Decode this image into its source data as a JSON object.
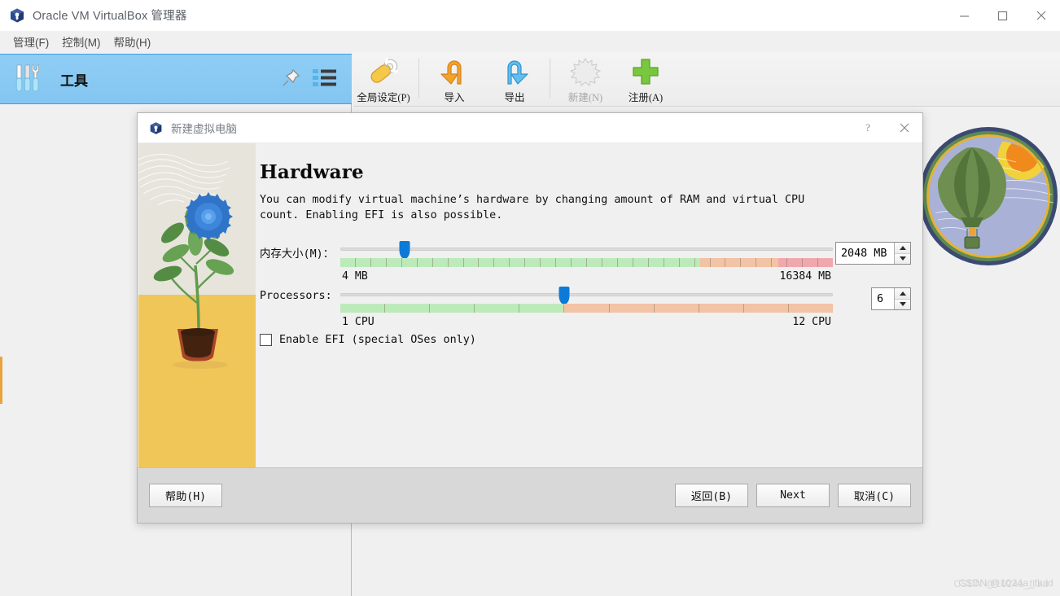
{
  "window": {
    "title": "Oracle VM VirtualBox 管理器",
    "icon": "virtualbox-cube-icon",
    "controls": {
      "minimize": "minimize-icon",
      "maximize": "maximize-icon",
      "close": "close-icon"
    }
  },
  "menubar": {
    "items": [
      {
        "label": "管理(F)"
      },
      {
        "label": "控制(M)"
      },
      {
        "label": "帮助(H)"
      }
    ]
  },
  "toolbar": {
    "buttons": [
      {
        "label": "全局设定(P)",
        "icon": "preferences-icon",
        "disabled": false
      },
      {
        "label": "导入",
        "icon": "import-appliance-icon",
        "disabled": false
      },
      {
        "label": "导出",
        "icon": "export-appliance-icon",
        "disabled": false
      },
      {
        "label": "新建(N)",
        "icon": "new-machine-icon",
        "disabled": true
      },
      {
        "label": "注册(A)",
        "icon": "register-machine-icon",
        "disabled": false
      }
    ]
  },
  "tools_strip": {
    "label": "工具",
    "tools_icon": "tools-icon",
    "pin_icon": "pin-icon",
    "list_icon": "list-view-icon"
  },
  "dialog": {
    "title": "新建虚拟电脑",
    "icon": "virtualbox-cube-icon",
    "help_icon": "help-question-icon",
    "close_icon": "close-icon",
    "heading": "Hardware",
    "description": "You can modify virtual machine’s hardware by changing amount of RAM and virtual CPU count. Enabling EFI is also possible.",
    "memory": {
      "label": "内存大小(M)：",
      "value": "2048 MB",
      "min_label": "4 MB",
      "max_label": "16384 MB",
      "handle_percent": 13,
      "bands": [
        {
          "color": "#bdeabb",
          "percent": 73
        },
        {
          "color": "#f2c3a5",
          "percent": 16
        },
        {
          "color": "#f0a8ad",
          "percent": 11
        }
      ],
      "tick_count": 32
    },
    "processors": {
      "label": "Processors:",
      "value": "6",
      "min_label": "1 CPU",
      "max_label": "12 CPU",
      "handle_percent": 45.5,
      "bands": [
        {
          "color": "#bdeabb",
          "percent": 45.5
        },
        {
          "color": "#f2c3a5",
          "percent": 54.5
        }
      ],
      "tick_count": 11
    },
    "efi": {
      "label": "Enable EFI (special OSes only)",
      "checked": false
    },
    "footer": {
      "help": "帮助(H)",
      "back": "返回(B)",
      "next": "Next",
      "cancel": "取消(C)"
    }
  },
  "watermark": {
    "text": "CSDN @1024a_fluid",
    "text2": "CSDN @1024a_fluid"
  },
  "colors": {
    "accent_blue": "#0c7ad6",
    "tools_strip": "#8fcdf4",
    "band_green": "#bdeabb",
    "band_orange": "#f2c3a5",
    "band_red": "#f0a8ad"
  }
}
